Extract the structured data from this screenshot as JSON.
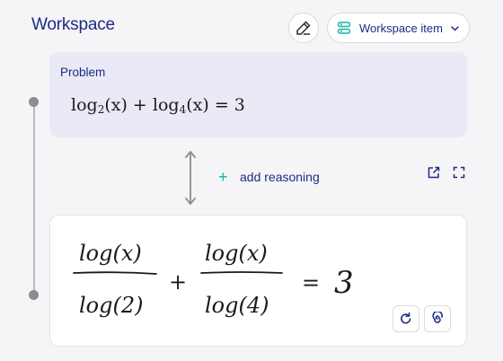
{
  "header": {
    "title": "Workspace",
    "edit_icon": "pencil-icon",
    "item_button": {
      "label": "Workspace item",
      "icon": "workspace-stack-icon",
      "chevron": "chevron-down-icon"
    }
  },
  "problem": {
    "label": "Problem",
    "equation": {
      "term1_fn": "log",
      "term1_base": "2",
      "term1_arg": "(x)",
      "op": "+",
      "term2_fn": "log",
      "term2_base": "4",
      "term2_arg": "(x)",
      "rhs": "= 3"
    }
  },
  "connector": {
    "add_reasoning_label": "add reasoning",
    "add_reasoning_icon": "plus-icon",
    "open_icon": "open-external-icon",
    "expand_icon": "expand-icon"
  },
  "work": {
    "handwriting": {
      "num1": "log(x)",
      "den1": "log(2)",
      "plus": "+",
      "num2": "log(x)",
      "den2": "log(4)",
      "eq": "=",
      "rhs": "3"
    },
    "redo_icon": "redo-icon",
    "spiral_icon": "spiral-icon"
  },
  "colors": {
    "accent": "#1f2a86",
    "teal": "#17b2aa",
    "card_problem": "#e9eaf6"
  }
}
